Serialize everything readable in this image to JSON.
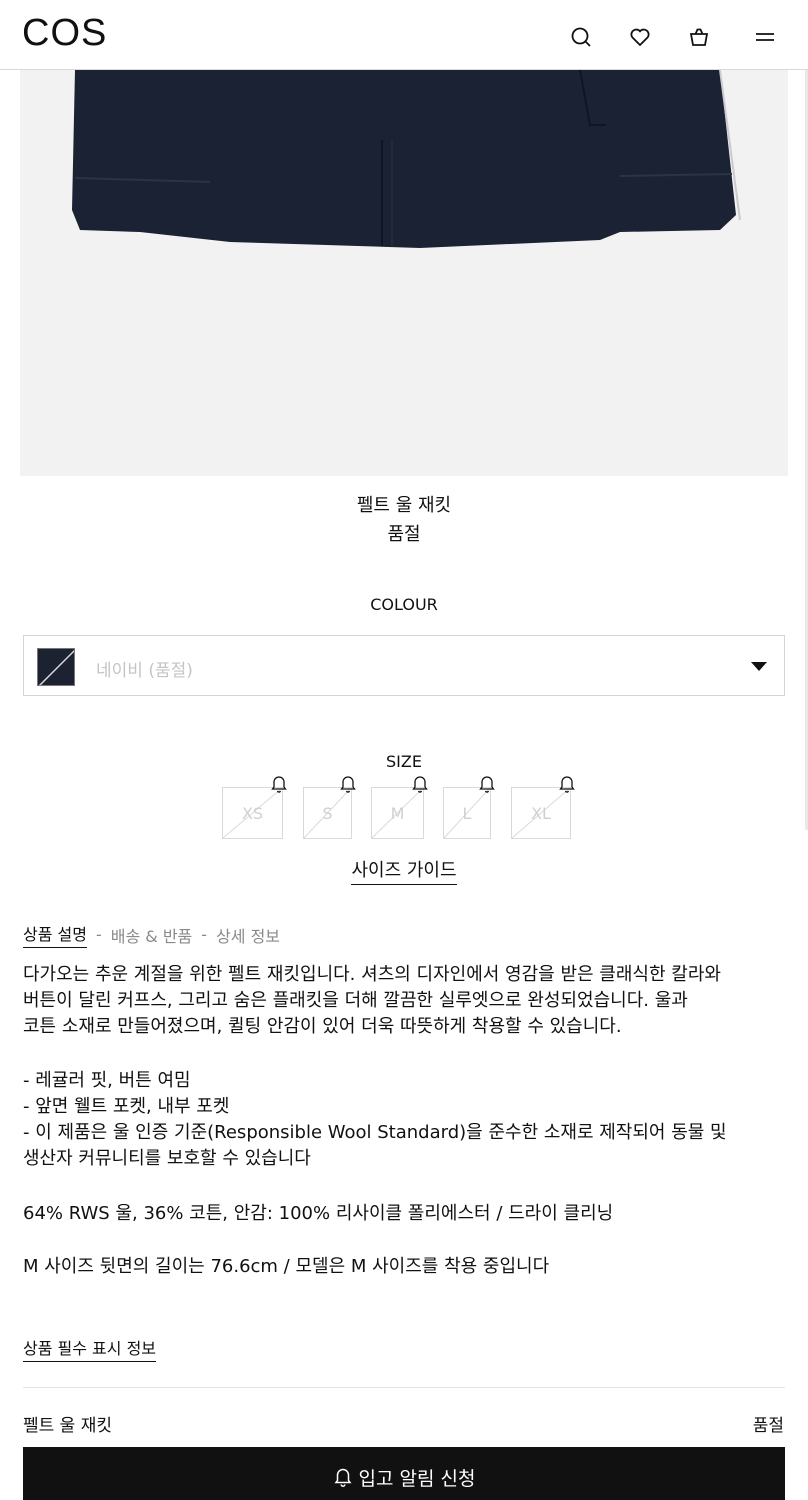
{
  "header": {
    "logo": "COS",
    "icons": [
      "search-icon",
      "heart-icon",
      "bag-icon",
      "menu-icon"
    ]
  },
  "product": {
    "name": "펠트 울 재킷",
    "status": "품절"
  },
  "colour": {
    "heading": "COLOUR",
    "selected": "네이비 (품절)",
    "swatch_color": "#1c2231"
  },
  "size": {
    "heading": "SIZE",
    "options": [
      "XS",
      "S",
      "M",
      "L",
      "XL"
    ],
    "guide_label": "사이즈 가이드"
  },
  "tabs": {
    "items": [
      "상품 설명",
      "배송 & 반품",
      "상세 정보"
    ],
    "separator": "-"
  },
  "description": {
    "lines": [
      "다가오는 추운 계절을 위한 펠트 재킷입니다. 셔츠의 디자인에서 영감을 받은 클래식한 칼라와",
      "버튼이 달린 커프스, 그리고 숨은 플래킷을 더해 깔끔한 실루엣으로 완성되었습니다. 울과",
      "코튼 소재로 만들어졌으며, 퀼팅 안감이 있어 더욱 따뜻하게 착용할 수 있습니다."
    ],
    "bullets": [
      "- 레귤러 핏, 버튼 여밈",
      "- 앞면 웰트 포켓, 내부 포켓",
      "- 이 제품은 울 인증 기준(Responsible Wool Standard)을 준수한 소재로 제작되어 동물 및",
      "생산자 커뮤니티를 보호할 수 있습니다"
    ],
    "composition": "64% RWS 울, 36% 코튼, 안감: 100% 리사이클 폴리에스터 / 드라이 클리닝",
    "model_info": "M 사이즈 뒷면의 길이는 76.6cm / 모델은 M 사이즈를 착용 중입니다"
  },
  "product_info_link": "상품 필수 표시 정보",
  "bottom_bar": {
    "name": "펠트 울 재킷",
    "status": "품절",
    "button_label": "입고 알림 신청"
  }
}
